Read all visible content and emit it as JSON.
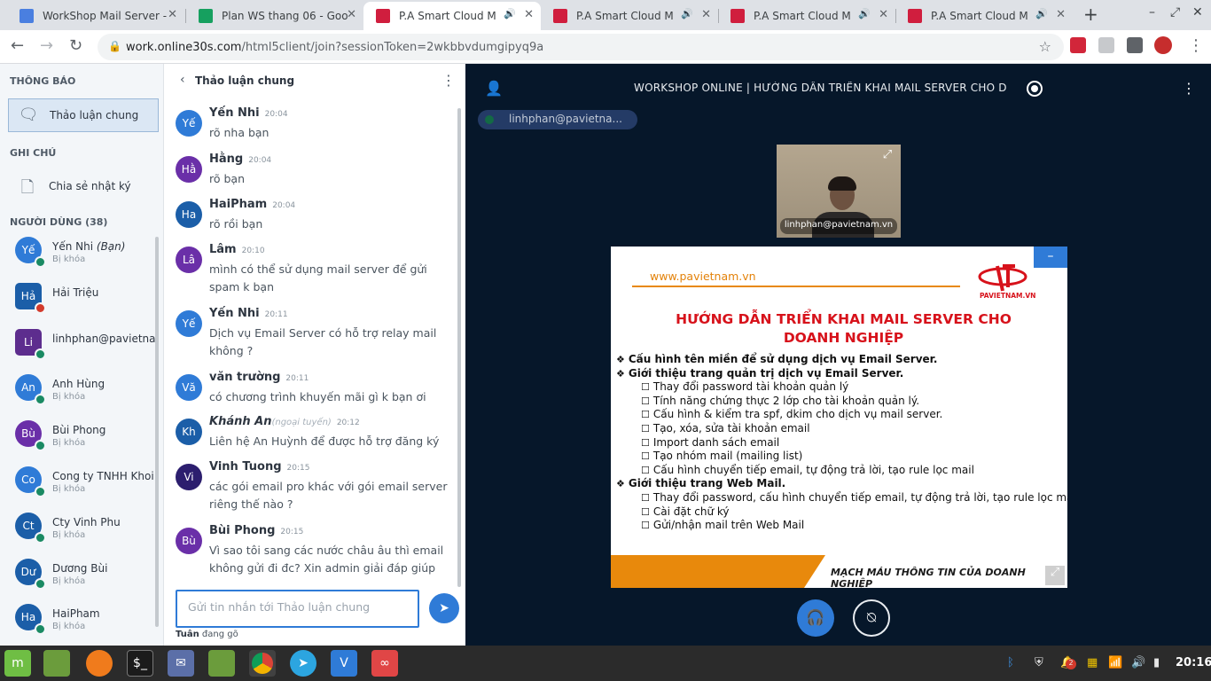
{
  "browser": {
    "tabs": [
      {
        "title": "WorkShop Mail Server -",
        "color": "#4a7fe0"
      },
      {
        "title": "Plan WS thang 06 - Goo",
        "color": "#16a05f"
      },
      {
        "title": "P.A Smart Cloud M",
        "color": "#d01e3e"
      },
      {
        "title": "P.A Smart Cloud M",
        "color": "#d01e3e"
      },
      {
        "title": "P.A Smart Cloud M",
        "color": "#d01e3e"
      },
      {
        "title": "P.A Smart Cloud M",
        "color": "#d01e3e"
      }
    ],
    "url_host": "work.online30s.com",
    "url_path": "/html5client/join?sessionToken=2wkbbvdumgipyq9a"
  },
  "sidebar": {
    "notifications_title": "THÔNG BÁO",
    "public_chat": "Thảo luận chung",
    "notes_title": "GHI CHÚ",
    "shared_notes": "Chia sẻ nhật ký",
    "users_title": "NGƯỜI DÙNG (38)",
    "users": [
      {
        "initials": "Yế",
        "name": "Yến Nhi",
        "you": "(Bạn)",
        "status": "Bị khóa",
        "color": "#2f7bd7",
        "badge": "#1a8a63",
        "square": false
      },
      {
        "initials": "Hả",
        "name": "Hải Triệu",
        "you": "",
        "status": "",
        "color": "#1b5ea8",
        "badge": "#d33a2c",
        "square": true
      },
      {
        "initials": "Li",
        "name": "linhphan@pavietna...",
        "you": "",
        "status": "",
        "color": "#5d2d8e",
        "badge": "#1a8a63",
        "square": true
      },
      {
        "initials": "An",
        "name": "Anh Hùng",
        "you": "",
        "status": "Bị khóa",
        "color": "#2f7bd7",
        "badge": "#1a8a63",
        "square": false
      },
      {
        "initials": "Bù",
        "name": "Bùi Phong",
        "you": "",
        "status": "Bị khóa",
        "color": "#6a2fa8",
        "badge": "#1a8a63",
        "square": false
      },
      {
        "initials": "Co",
        "name": "Cong ty TNHH Khoi ...",
        "you": "",
        "status": "Bị khóa",
        "color": "#2f7bd7",
        "badge": "#1a8a63",
        "square": false
      },
      {
        "initials": "Ct",
        "name": "Cty Vinh Phu",
        "you": "",
        "status": "Bị khóa",
        "color": "#1b5ea8",
        "badge": "#1a8a63",
        "square": false
      },
      {
        "initials": "Dư",
        "name": "Dương Bùi",
        "you": "",
        "status": "Bị khóa",
        "color": "#1b5ea8",
        "badge": "#1a8a63",
        "square": false
      },
      {
        "initials": "Ha",
        "name": "HaiPham",
        "you": "",
        "status": "Bị khóa",
        "color": "#1b5ea8",
        "badge": "#1a8a63",
        "square": false
      }
    ]
  },
  "chat": {
    "title": "Thảo luận chung",
    "messages": [
      {
        "initials": "Yế",
        "sender": "Yến Nhi",
        "offline": "",
        "time": "20:04",
        "text": "rõ nha bạn",
        "color": "#2f7bd7"
      },
      {
        "initials": "Hằ",
        "sender": "Hằng",
        "offline": "",
        "time": "20:04",
        "text": "rõ bạn",
        "color": "#6a2fa8"
      },
      {
        "initials": "Ha",
        "sender": "HaiPham",
        "offline": "",
        "time": "20:04",
        "text": "rõ rồi bạn",
        "color": "#1b5ea8"
      },
      {
        "initials": "Lâ",
        "sender": "Lâm",
        "offline": "",
        "time": "20:10",
        "text": "mình có thể sử dụng mail server để gửi spam k bạn",
        "color": "#6a2fa8"
      },
      {
        "initials": "Yế",
        "sender": "Yến Nhi",
        "offline": "",
        "time": "20:11",
        "text": "Dịch vụ Email Server có hỗ trợ relay mail không ?",
        "color": "#2f7bd7"
      },
      {
        "initials": "Vă",
        "sender": "văn trường",
        "offline": "",
        "time": "20:11",
        "text": "có chương trình khuyến mãi gì k bạn ơi",
        "color": "#2f7bd7"
      },
      {
        "initials": "Kh",
        "sender": "Khánh An",
        "offline": "(ngoại tuyến)",
        "time": "20:12",
        "text": "Liên hệ An Huỳnh để được hỗ trợ đăng ký",
        "color": "#1b5ea8"
      },
      {
        "initials": "Vi",
        "sender": "Vinh Tuong",
        "offline": "",
        "time": "20:15",
        "text": "các gói email pro khác với gói email server riêng thế nào ?",
        "color": "#2c1e6e"
      },
      {
        "initials": "Bù",
        "sender": "Bùi Phong",
        "offline": "",
        "time": "20:15",
        "text": "Vì sao tôi sang các nước châu âu thì email không gửi đi đc? Xin admin giải đáp giúp",
        "color": "#6a2fa8"
      }
    ],
    "input_placeholder": "Gửi tin nhắn tới Thảo luận chung",
    "typing_user": "Tuân",
    "typing_text": "đang gõ"
  },
  "meeting": {
    "title": "WORKSHOP ONLINE | HƯỚNG DẪN TRIỂN KHAI MAIL SERVER CHO DOA...",
    "talker": "linhphan@pavietna...",
    "webcam_name": "linhphan@pavietnam.vn",
    "slide": {
      "site": "www.pavietnam.vn",
      "logo_text": "PAVIETNAM.VN",
      "title_line1": "HƯỚNG DẪN TRIỂN KHAI MAIL SERVER CHO",
      "title_line2": "DOANH NGHIỆP",
      "bullets": [
        {
          "level": 1,
          "text": "Cấu hình tên miền để sử dụng dịch vụ Email Server."
        },
        {
          "level": 1,
          "text": "Giới thiệu trang quản trị dịch vụ Email Server."
        },
        {
          "level": 2,
          "text": "Thay đổi password tài khoản quản lý"
        },
        {
          "level": 2,
          "text": "Tính năng chứng thực 2 lớp cho tài khoản quản lý."
        },
        {
          "level": 2,
          "text": "Cấu hình & kiểm tra spf, dkim cho dịch vụ mail server."
        },
        {
          "level": 2,
          "text": "Tạo, xóa, sửa tài khoản email"
        },
        {
          "level": 2,
          "text": "Import danh sách email"
        },
        {
          "level": 2,
          "text": "Tạo nhóm mail (mailing list)"
        },
        {
          "level": 2,
          "text": "Cấu hình chuyển tiếp email, tự động trả lời, tạo rule lọc mail"
        },
        {
          "level": 1,
          "text": "Giới thiệu trang Web Mail."
        },
        {
          "level": 2,
          "text": "Thay đổi password, cấu hình chuyển tiếp email, tự động trả lời, tạo rule lọc mail"
        },
        {
          "level": 2,
          "text": "Cài đặt chữ ký"
        },
        {
          "level": 2,
          "text": "Gửi/nhận mail trên Web Mail"
        }
      ],
      "footer": "MẠCH MÁU THÔNG TIN CỦA DOANH NGHIỆP"
    }
  },
  "taskbar": {
    "notification_count": "2",
    "clock": "20:16"
  }
}
